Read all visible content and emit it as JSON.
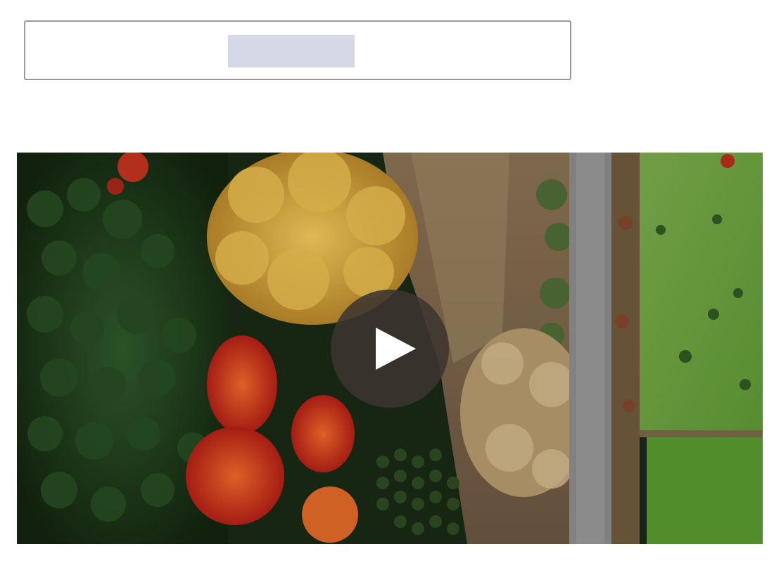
{
  "toolbar": {
    "placeholder_block_color": "#d5d8e6",
    "border_color": "#9a9a9a"
  },
  "video": {
    "description_icon": "play-icon",
    "overlay_color": "#3c3630"
  }
}
